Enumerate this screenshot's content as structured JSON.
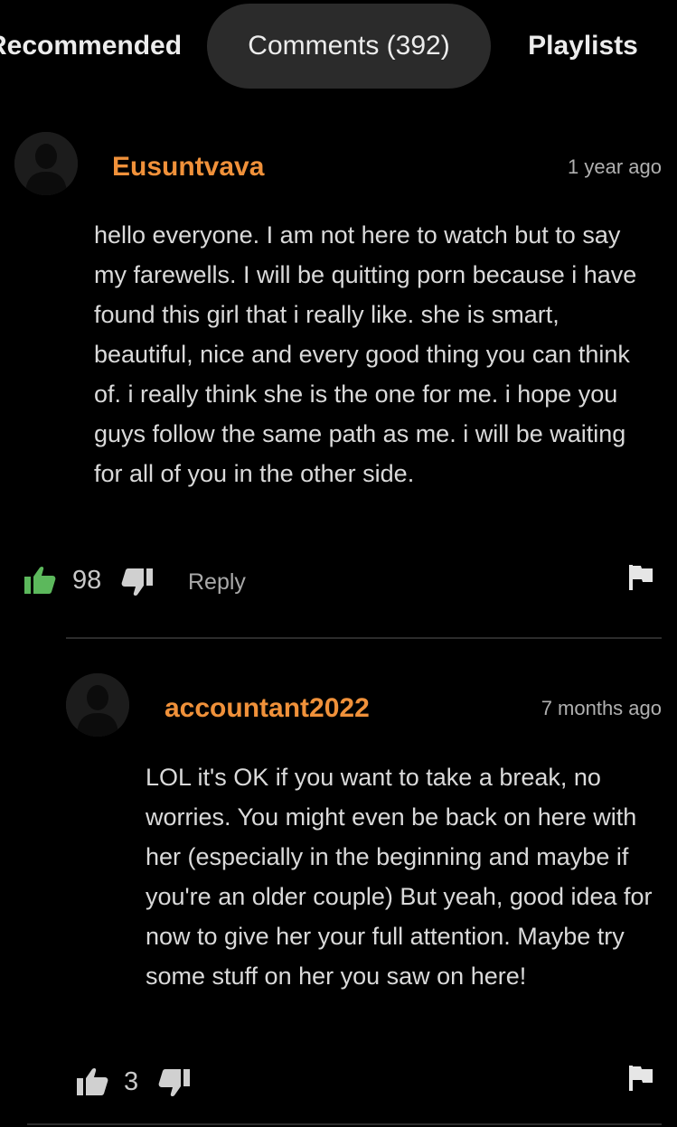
{
  "tabs": [
    {
      "label": "Recommended"
    },
    {
      "label": "Comments (392)",
      "active": true
    },
    {
      "label": "Playlists"
    }
  ],
  "colors": {
    "background": "#000000",
    "active_tab": "#2b2b2b",
    "username": "#f0913a",
    "liked_thumb": "#5cb85c",
    "text": "#dadada"
  },
  "comments": [
    {
      "avatar_icon": "user-silhouette-icon",
      "username": "Eusuntvava",
      "time": "1 year ago",
      "body": "hello everyone. I am not here to watch but to say my farewells. I will be quitting porn because i have found this girl that i really like. she is smart, beautiful, nice and every good thing you can think of. i really think she is the one for me. i hope you guys follow the same path as me. i will be waiting for all of you in the other side.",
      "likes": "98",
      "liked": true,
      "reply_label": "Reply",
      "icons": {
        "like": "thumbs-up-icon",
        "dislike": "thumbs-down-icon",
        "report": "flag-icon"
      }
    },
    {
      "avatar_icon": "user-silhouette-icon",
      "username": "accountant2022",
      "time": "7 months ago",
      "body": "LOL it's OK if you want to take a break, no worries. You might even be back on here with her (especially in the beginning and maybe if you're an older couple) But yeah, good idea for now to give her your full attention. Maybe try some stuff on her you saw on here!",
      "likes": "3",
      "liked": false,
      "icons": {
        "like": "thumbs-up-icon",
        "dislike": "thumbs-down-icon",
        "report": "flag-icon"
      }
    }
  ]
}
